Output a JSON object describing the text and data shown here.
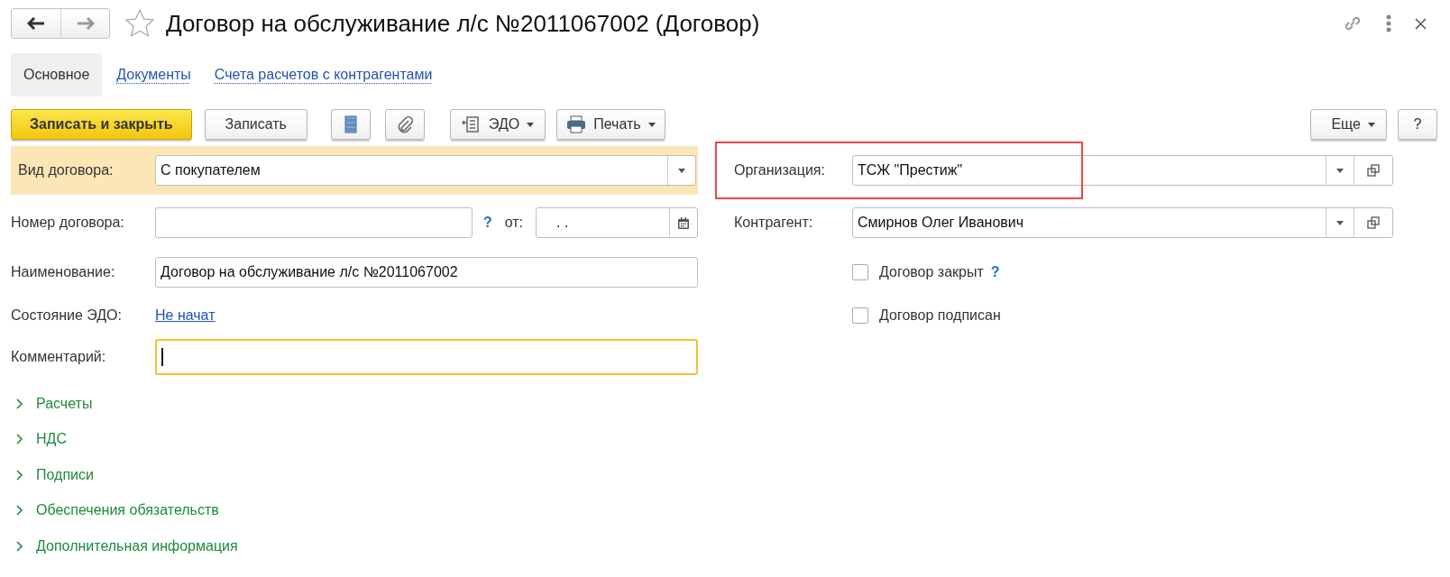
{
  "header": {
    "title": "Договор на обслуживание л/с №2011067002 (Договор)",
    "favorite": false
  },
  "tabs": [
    {
      "label": "Основное",
      "selected": true
    },
    {
      "label": "Документы",
      "selected": false
    },
    {
      "label": "Счета расчетов с контрагентами",
      "selected": false
    }
  ],
  "toolbar": {
    "save_close": "Записать и закрыть",
    "save": "Записать",
    "edo": "ЭДО",
    "print": "Печать",
    "more": "Еще",
    "help": "?"
  },
  "left": {
    "contract_type": {
      "label": "Вид договора:",
      "value": "С покупателем",
      "highlighted": true
    },
    "number": {
      "label": "Номер договора:",
      "help": "?",
      "date_label": "от:",
      "date_value": ".  ."
    },
    "name": {
      "label": "Наименование:",
      "value": "Договор на обслуживание л/с №2011067002"
    },
    "edo_status": {
      "label": "Состояние ЭДО:",
      "link": "Не начат"
    },
    "comment": {
      "label": "Комментарий:",
      "focused": true
    }
  },
  "right": {
    "organization": {
      "label": "Организация:",
      "value": "ТСЖ \"Престиж\"",
      "highlighted": true
    },
    "counterparty": {
      "label": "Контрагент:",
      "value": "Смирнов Олег Иванович"
    },
    "checkboxes": [
      {
        "label": "Договор закрыт",
        "checked": false,
        "help": "?"
      },
      {
        "label": "Договор подписан",
        "checked": false
      }
    ]
  },
  "groups": [
    {
      "label": "Расчеты",
      "expanded": false
    },
    {
      "label": "НДС",
      "expanded": false
    },
    {
      "label": "Подписи",
      "expanded": false
    },
    {
      "label": "Обеспечения обязательств",
      "expanded": false
    },
    {
      "label": "Дополнительная информация",
      "expanded": false
    }
  ]
}
